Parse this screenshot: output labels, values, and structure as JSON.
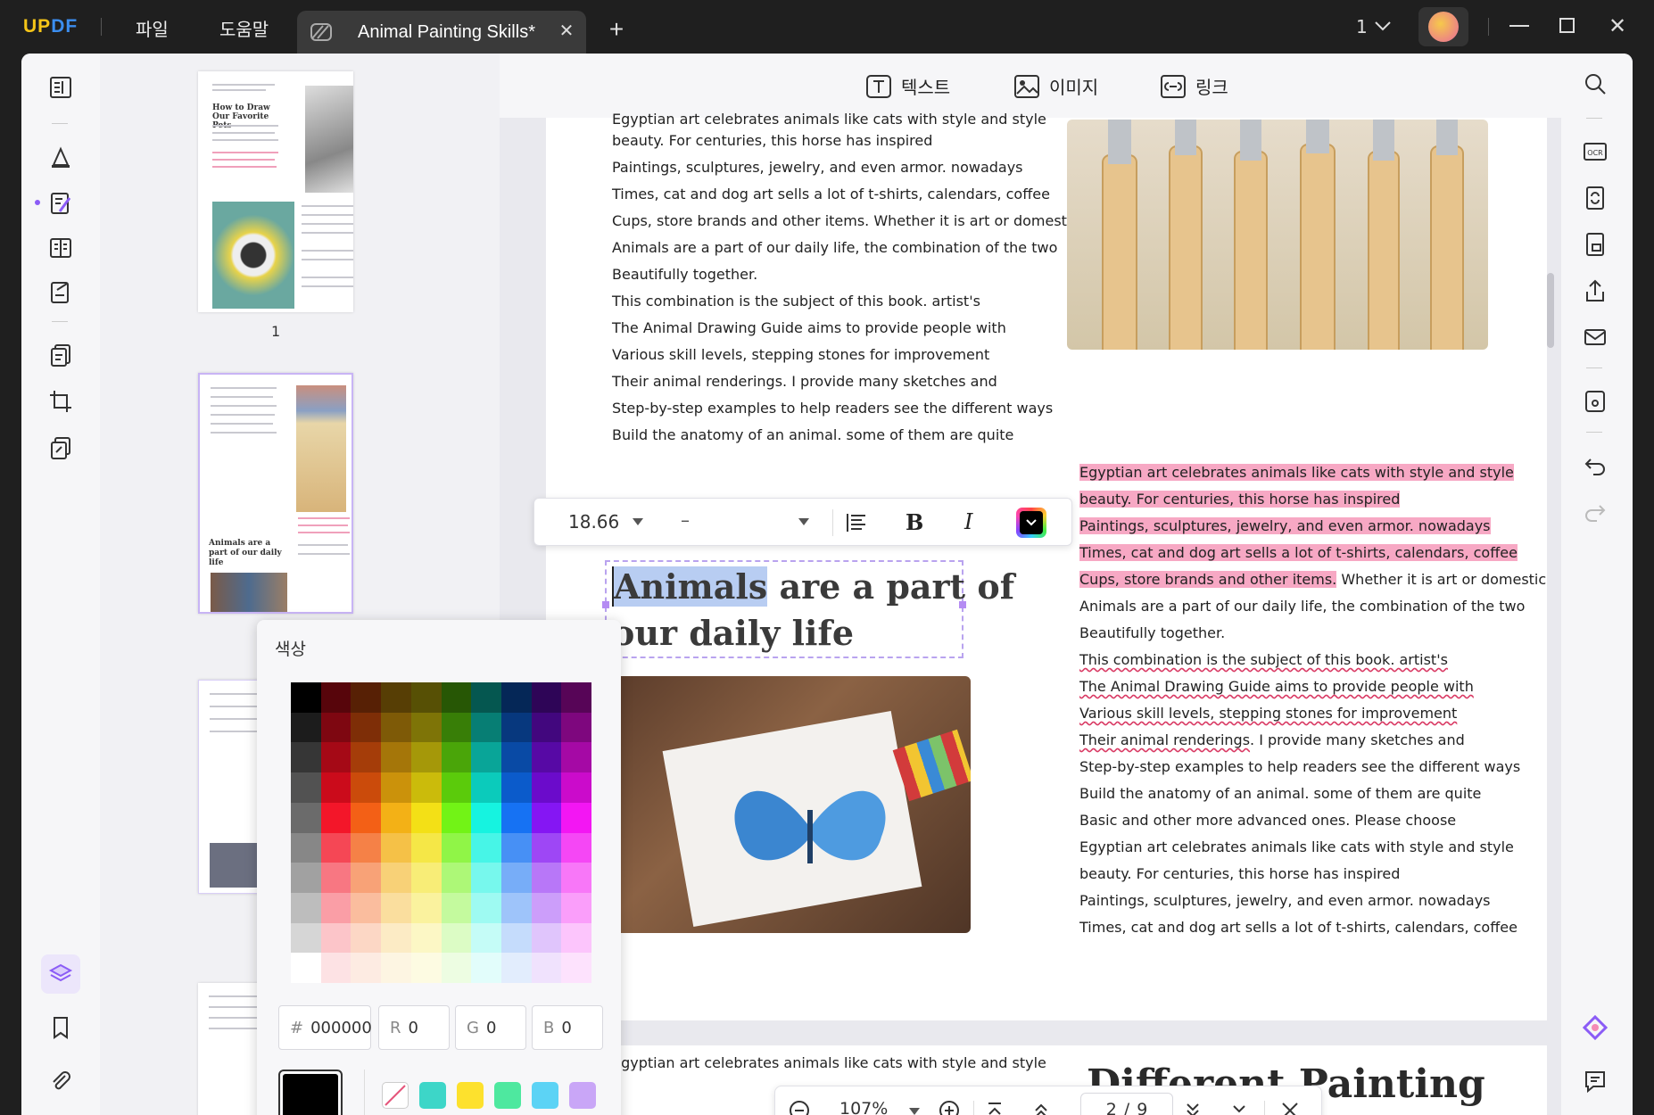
{
  "app": {
    "logo_prefix": "UP",
    "logo_suffix": "DF",
    "menu_file": "파일",
    "menu_help": "도움말",
    "tab_title": "Animal Painting Skills*",
    "page_selector": "1"
  },
  "edit_toolbar": {
    "text_label": "텍스트",
    "image_label": "이미지",
    "link_label": "링크"
  },
  "thumbnails": {
    "page1_number": "1",
    "page2_heading": "Animals are a part of our daily life",
    "page1_heading": "How to Draw Our Favorite Pets"
  },
  "left_column": [
    "Egyptian art celebrates animals like cats with style and style",
    "beauty. For centuries, this horse has inspired",
    "Paintings, sculptures, jewelry, and even armor. nowadays",
    "Times, cat and dog art sells a lot of t-shirts, calendars, coffee",
    "Cups, store brands and other items. Whether it is art or domestic",
    "Animals are a part of our daily life, the combination of the two",
    "Beautifully together.",
    "This combination is the subject of this book. artist's",
    "The Animal Drawing Guide aims to provide people with",
    "Various skill levels, stepping stones for improvement",
    "Their animal renderings. I provide many sketches and",
    "Step-by-step examples to help readers see the different ways",
    "Build the anatomy of an animal. some of them are quite"
  ],
  "heading": {
    "selected": "Animals",
    "rest": " are a part of",
    "line2": "our daily life"
  },
  "right_column": {
    "highlighted": [
      "Egyptian art celebrates animals like cats with style and style",
      "beauty. For centuries, this horse has inspired",
      "Paintings, sculptures, jewelry, and even armor. nowadays",
      "Times, cat and dog art sells a lot of t-shirts, calendars, coffee"
    ],
    "line5_hl": "Cups, store brands and other items.",
    "line5_rest": " Whether it is art or domestic",
    "plain_a": [
      "Animals are a part of our daily life, the combination of the two",
      "Beautifully together."
    ],
    "wavy": [
      "This combination is the subject of this book. artist's",
      "The Animal Drawing Guide aims to provide people with",
      "Various skill levels, stepping stones for improvement"
    ],
    "line11_wavy": "Their animal renderings",
    "line11_rest": ". I provide many sketches and",
    "plain_b": [
      "Step-by-step examples to help readers see the different ways",
      "Build the anatomy of an animal. some of them are quite",
      "Basic and other more advanced ones. Please choose",
      "Egyptian art celebrates animals like cats with style and style",
      "beauty. For centuries, this horse has inspired",
      "Paintings, sculptures, jewelry, and even armor. nowadays",
      "Times, cat and dog art sells a lot of t-shirts, calendars, coffee"
    ]
  },
  "page2": {
    "left_text": "Egyptian art celebrates animals like cats with style and style",
    "heading": "Different Painting"
  },
  "format_toolbar": {
    "font_size": "18.66",
    "font_name": "–"
  },
  "color_popup": {
    "title": "색상",
    "hex_prefix": "#",
    "hex": "000000",
    "r_label": "R",
    "r": "0",
    "g_label": "G",
    "g": "0",
    "b_label": "B",
    "b": "0",
    "current_color": "#000000",
    "preset_colors": [
      "#3dd6c8",
      "#fde12d",
      "#4ee89f",
      "#5cd3f5",
      "#c9a6f7",
      "#f7a8c4"
    ]
  },
  "zoom": {
    "level": "107%",
    "current_page": "2",
    "total_pages": "9",
    "page_sep": "/"
  },
  "colors": {
    "accent": "#8b5cf6",
    "highlight": "#f7a8c4",
    "squiggle": "#d93a64"
  }
}
